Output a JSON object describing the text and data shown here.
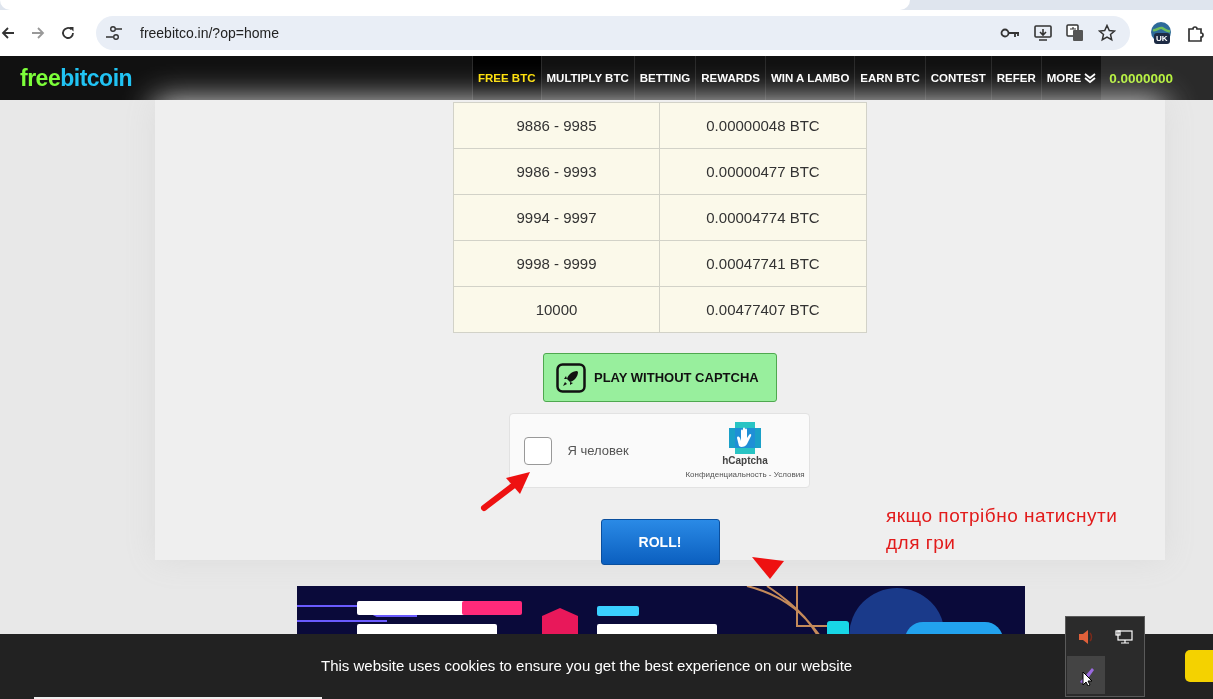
{
  "browser": {
    "url": "freebitco.in/?op=home",
    "profile_badge": "UK"
  },
  "nav": {
    "logo_parts": [
      "free",
      "bitcoin"
    ],
    "items": [
      {
        "label": "FREE BTC",
        "selected": true
      },
      {
        "label": "MULTIPLY BTC",
        "selected": false
      },
      {
        "label": "BETTING",
        "selected": false
      },
      {
        "label": "REWARDS",
        "selected": false
      },
      {
        "label": "WIN A LAMBO",
        "selected": false
      },
      {
        "label": "EARN BTC",
        "selected": false
      },
      {
        "label": "CONTEST",
        "selected": false
      },
      {
        "label": "REFER",
        "selected": false
      },
      {
        "label": "MORE",
        "selected": false
      }
    ],
    "balance": "0.0000000"
  },
  "payout_table": {
    "rows": [
      {
        "range": "9886 - 9985",
        "payout": "0.00000048 BTC"
      },
      {
        "range": "9986 - 9993",
        "payout": "0.00000477 BTC"
      },
      {
        "range": "9994 - 9997",
        "payout": "0.00004774 BTC"
      },
      {
        "range": "9998 - 9999",
        "payout": "0.00047741 BTC"
      },
      {
        "range": "10000",
        "payout": "0.00477407 BTC"
      }
    ]
  },
  "play_button": "PLAY WITHOUT CAPTCHA",
  "captcha": {
    "label": "Я человек",
    "checked": false,
    "brand": "hCaptcha",
    "links": "Конфиденциальность - Условия"
  },
  "roll_button": "ROLL!",
  "annotation": "якщо потрібно натиснути для гри",
  "cookie_notice": "This website uses cookies to ensure you get the best experience on our website"
}
